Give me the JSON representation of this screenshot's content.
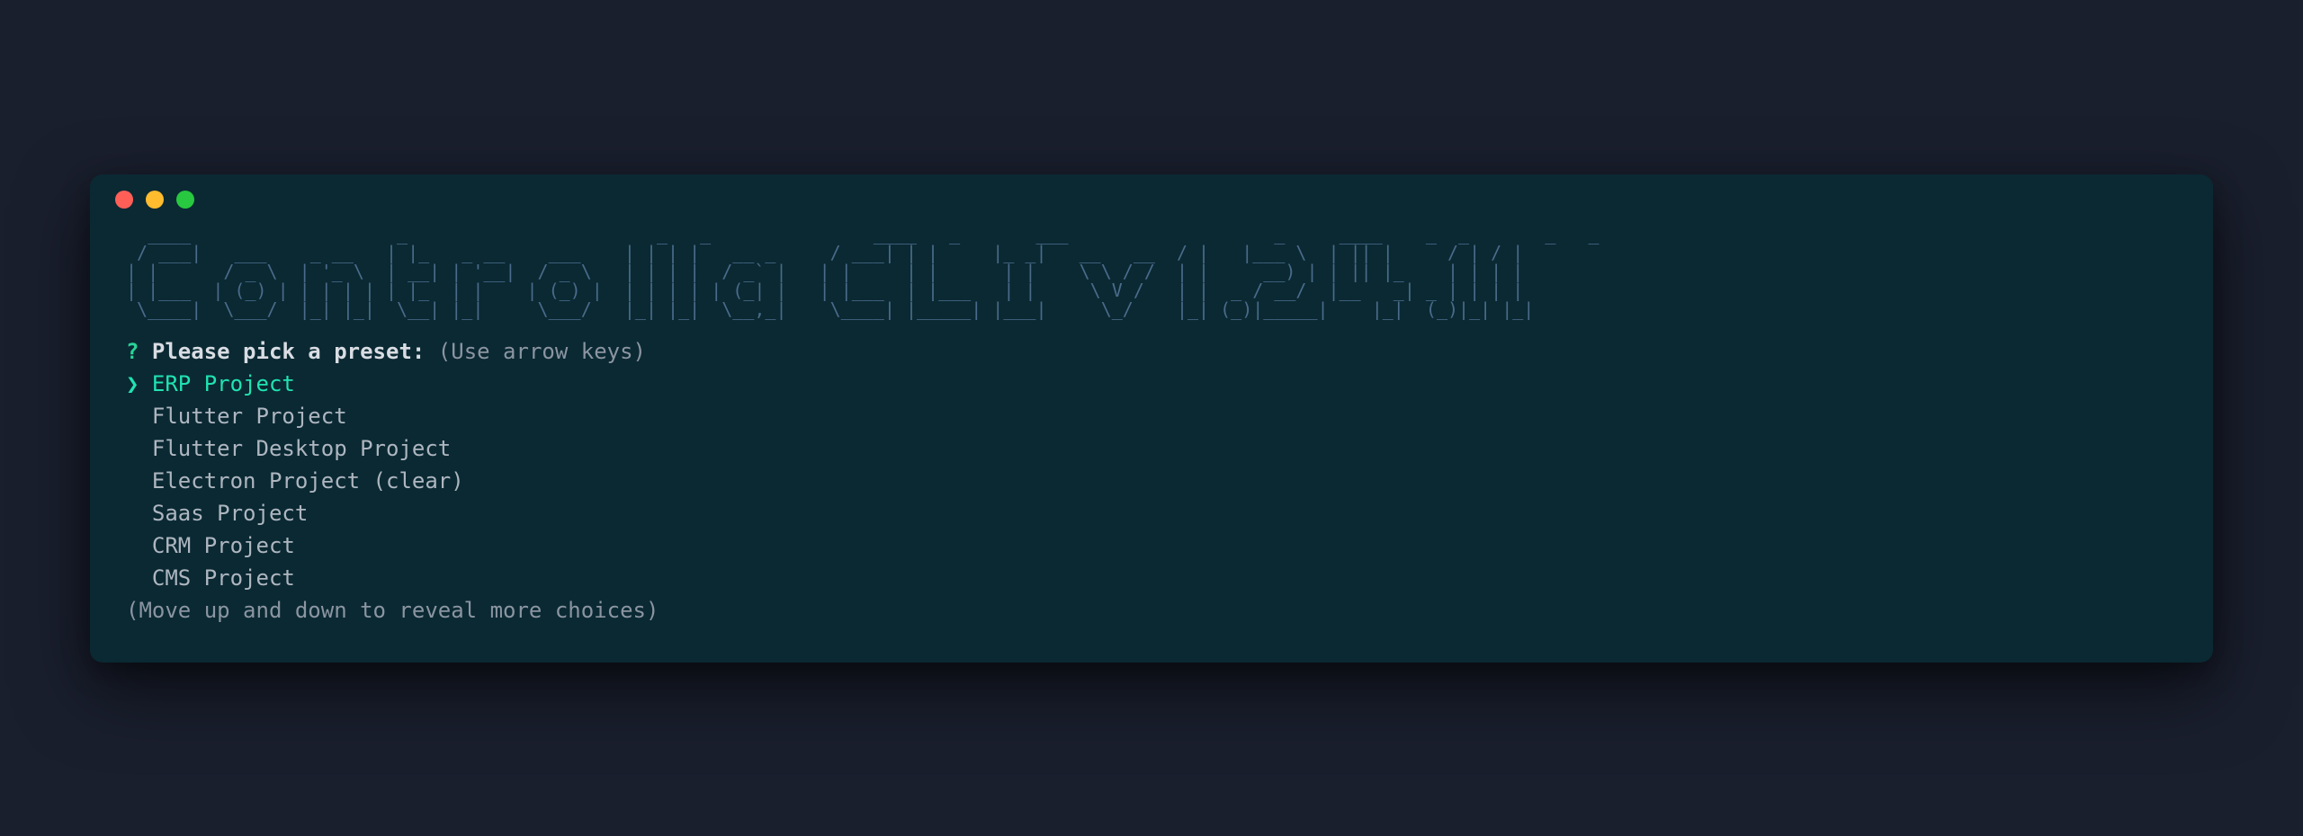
{
  "banner_ascii": "  ____                   _                       _   _               ____   _       ___                   _     ____    _  _       _   _ \n / ___|   ___    _ __   | |_   _ __    ___    | | | |   __ _     / ___| | |     |_ _|   __   __  / |   |___ \\  | || |     / | / |\n| |      / _ \\  | '_ \\  | __| | '__|  / _ \\   | | | |  / _` |   | |     | |      | |    \\ \\ / /  | |     __) | | || |_    | | | |\n| |___  | (_) | | | | | | |_  | |    | (_) |  | | | | | (_| |   | |___  | |___   | |     \\ V /   | |  _ / __/  |__   _| _ | | | |\n \\____|  \\___/  |_| |_|  \\__| |_|     \\___/   |_| |_|  \\__,_|    \\____| |_____| |___|     \\_/    |_| (_)|_____|    |_|  (_)|_| |_|",
  "prompt": {
    "question_mark": "?",
    "text": "Please pick a preset:",
    "hint": "(Use arrow keys)"
  },
  "pointer": "❯",
  "options": [
    {
      "label": "ERP Project",
      "selected": true
    },
    {
      "label": "Flutter Project",
      "selected": false
    },
    {
      "label": "Flutter Desktop Project",
      "selected": false
    },
    {
      "label": "Electron Project (clear)",
      "selected": false
    },
    {
      "label": "Saas Project",
      "selected": false
    },
    {
      "label": "CRM Project",
      "selected": false
    },
    {
      "label": "CMS Project",
      "selected": false
    }
  ],
  "footer_hint": "(Move up and down to reveal more choices)"
}
